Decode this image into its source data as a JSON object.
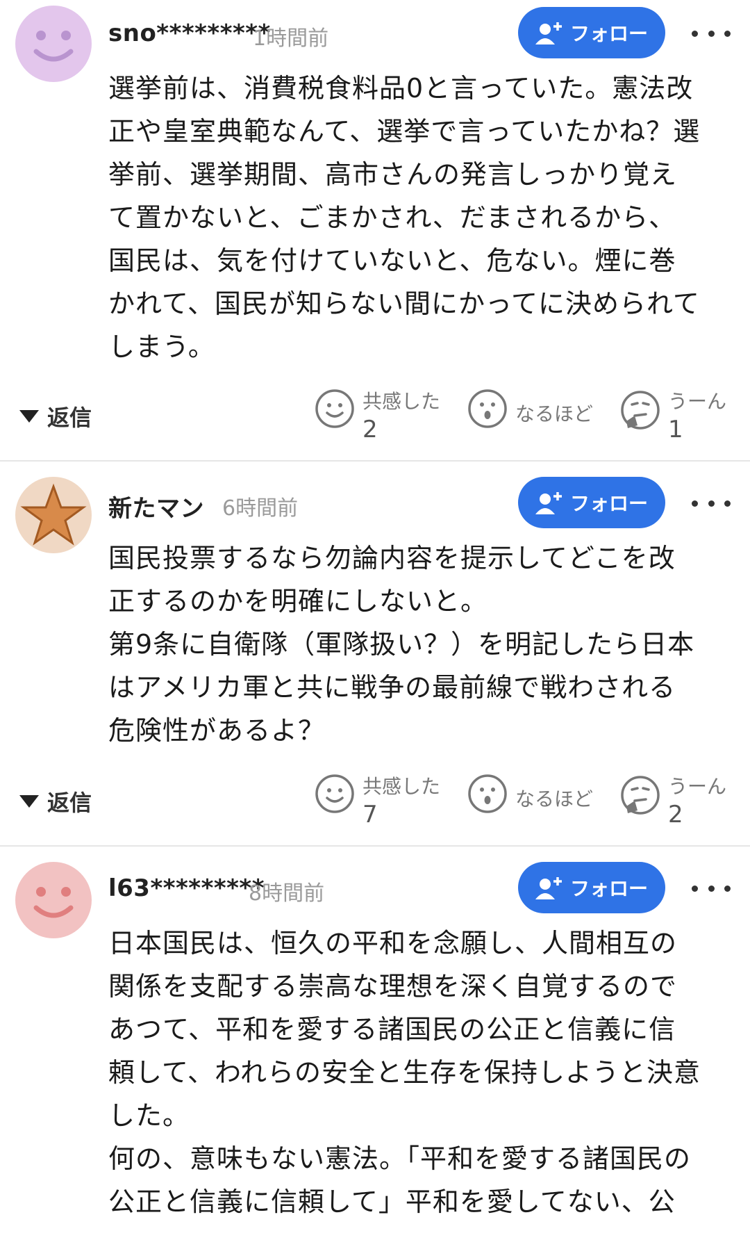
{
  "comments": [
    {
      "username": "sno*********",
      "time": "1時間前",
      "follow_label": "フォロー",
      "avatar_color": "#e3c6ec",
      "avatar_icon": "smiley-face-icon",
      "lines": [
        "選挙前は、消費税食料品0と言っていた。憲法改",
        "正や皇室典範なんて、選挙で言っていたかね？選",
        "挙前、選挙期間、高市さんの発言しっかり覚え",
        "て置かないと、ごまかされ、だまされるから、",
        "国民は、気を付けていないと、危ない。煙に巻",
        "かれて、国民が知らない間にかってに決められて",
        "しまう。"
      ],
      "reply_label": "返信",
      "reactions": [
        {
          "label": "共感した",
          "count": "2",
          "icon": "smile-reaction-icon"
        },
        {
          "label": "なるほど",
          "count": "",
          "icon": "surprised-reaction-icon"
        },
        {
          "label": "うーん",
          "count": "1",
          "icon": "thinking-reaction-icon"
        }
      ]
    },
    {
      "username": "新たマン",
      "time": "6時間前",
      "follow_label": "フォロー",
      "avatar_color": "#f0d8c4",
      "avatar_icon": "star-icon",
      "lines": [
        "国民投票するなら勿論内容を提示してどこを改",
        "正するのかを明確にしないと。",
        "第9条に自衛隊（軍隊扱い？）を明記したら日本",
        "はアメリカ軍と共に戦争の最前線で戦わされる",
        "危険性があるよ？"
      ],
      "reply_label": "返信",
      "reactions": [
        {
          "label": "共感した",
          "count": "7",
          "icon": "smile-reaction-icon"
        },
        {
          "label": "なるほど",
          "count": "",
          "icon": "surprised-reaction-icon"
        },
        {
          "label": "うーん",
          "count": "2",
          "icon": "thinking-reaction-icon"
        }
      ]
    },
    {
      "username": "l63*********",
      "time": "8時間前",
      "follow_label": "フォロー",
      "avatar_color": "#f2c2c2",
      "avatar_icon": "smiley-face-icon",
      "lines": [
        "日本国民は、恒久の平和を念願し、人間相互の",
        "関係を支配する崇高な理想を深く自覚するので",
        "あつて、平和を愛する諸国民の公正と信義に信",
        "頼して、われらの安全と生存を保持しようと決意",
        "した。",
        "何の、意味もない憲法。「平和を愛する諸国民の",
        "公正と信義に信頼して」平和を愛してない、公"
      ]
    }
  ],
  "colors": {
    "follow_button": "#2f73e6",
    "timestamp": "#9a9a9a",
    "divider": "#e6e6e6"
  }
}
